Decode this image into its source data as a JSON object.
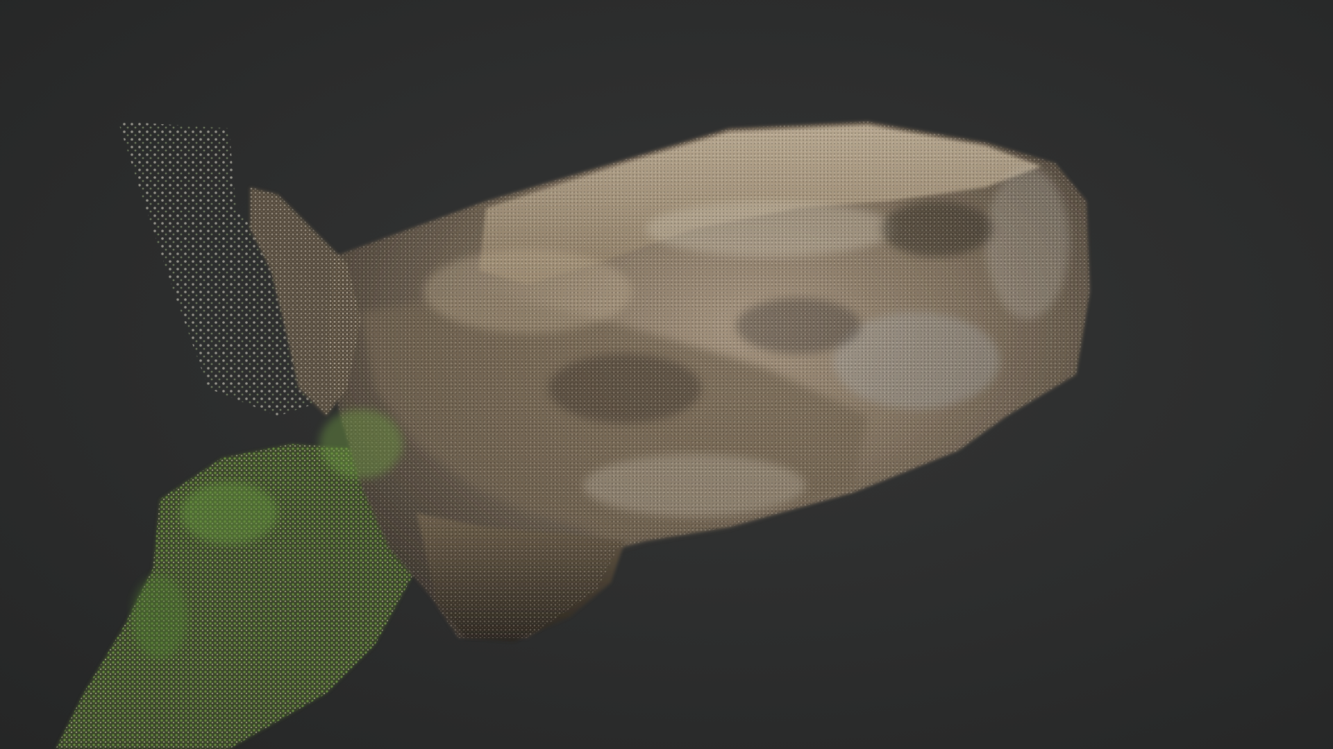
{
  "viewer": {
    "background_color": "#2b2c2c"
  },
  "scene": {
    "subject": "rock-point-cloud",
    "palette": {
      "rock_light": "#b9a78e",
      "rock_mid": "#8a7a66",
      "rock_dark": "#4a4238",
      "rock_shadow": "#2f2a24",
      "moss": "#5f8a3a",
      "moss_bright": "#7fb04a",
      "highlight": "#d9d2c3",
      "bluish_grey": "#9aa0a6"
    }
  }
}
